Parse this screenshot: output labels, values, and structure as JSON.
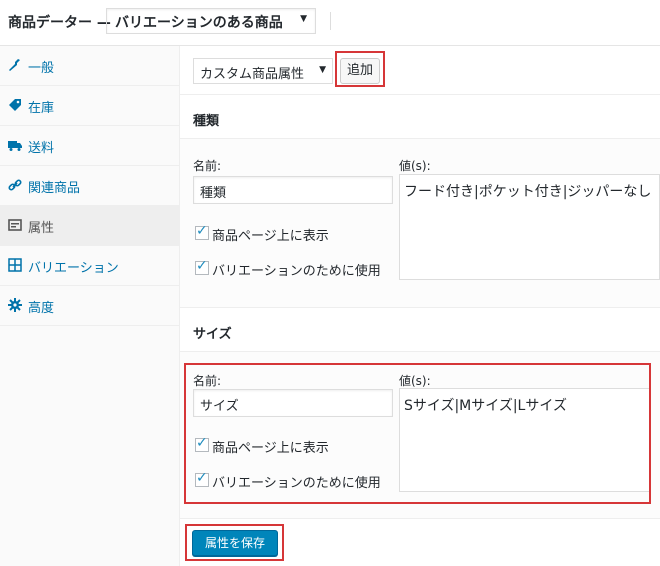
{
  "header": {
    "title": "商品データー —",
    "product_type": "バリエーションのある商品"
  },
  "tabs": [
    {
      "label": "一般",
      "icon": "wrench-icon"
    },
    {
      "label": "在庫",
      "icon": "tag-icon"
    },
    {
      "label": "送料",
      "icon": "truck-icon"
    },
    {
      "label": "関連商品",
      "icon": "link-icon"
    },
    {
      "label": "属性",
      "icon": "list-icon"
    },
    {
      "label": "バリエーション",
      "icon": "grid-icon"
    },
    {
      "label": "高度",
      "icon": "gear-icon"
    }
  ],
  "toolbar": {
    "attribute_select": "カスタム商品属性",
    "add_label": "追加"
  },
  "attributes": [
    {
      "title": "種類",
      "name_label": "名前:",
      "name": "種類",
      "values_label": "値(s):",
      "values": "フード付き|ポケット付き|ジッパーなし",
      "visible_label": "商品ページ上に表示",
      "variation_label": "バリエーションのために使用"
    },
    {
      "title": "サイズ",
      "name_label": "名前:",
      "name": "サイズ",
      "values_label": "値(s):",
      "values": "Sサイズ|Mサイズ|Lサイズ",
      "visible_label": "商品ページ上に表示",
      "variation_label": "バリエーションのために使用"
    }
  ],
  "save_label": "属性を保存"
}
